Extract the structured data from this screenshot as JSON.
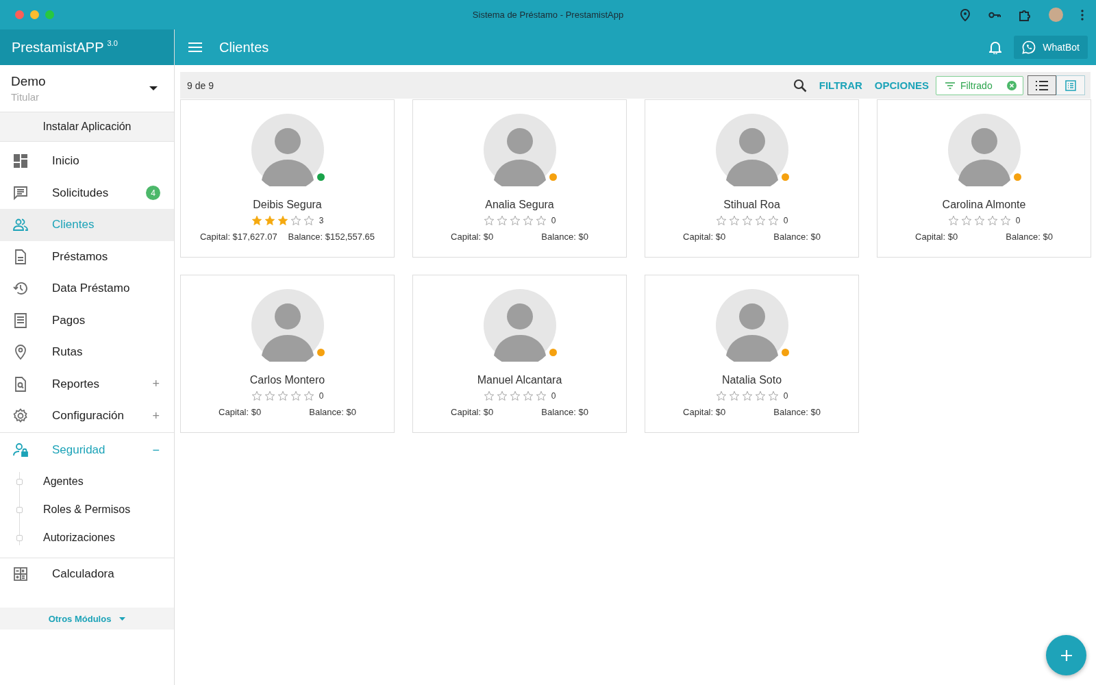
{
  "window": {
    "title": "Sistema de Préstamo - PrestamistApp"
  },
  "app": {
    "name": "PrestamistAPP",
    "version": "3.0",
    "page_title": "Clientes",
    "whatbot": "WhatBot"
  },
  "account": {
    "name": "Demo",
    "role": "Titular"
  },
  "install_button": "Instalar Aplicación",
  "sidebar": {
    "items": [
      {
        "label": "Inicio",
        "selected": false
      },
      {
        "label": "Solicitudes",
        "selected": false,
        "badge": "4"
      },
      {
        "label": "Clientes",
        "selected": true
      },
      {
        "label": "Préstamos",
        "selected": false
      },
      {
        "label": "Data Préstamo",
        "selected": false
      },
      {
        "label": "Pagos",
        "selected": false
      },
      {
        "label": "Rutas",
        "selected": false
      },
      {
        "label": "Reportes",
        "selected": false,
        "toggle": "+",
        "expanded": false
      },
      {
        "label": "Configuración",
        "selected": false,
        "toggle": "+",
        "expanded": false
      },
      {
        "label": "Seguridad",
        "selected": false,
        "toggle": "−",
        "expanded": true,
        "children": [
          {
            "label": "Agentes"
          },
          {
            "label": "Roles & Permisos"
          },
          {
            "label": "Autorizaciones"
          }
        ]
      },
      {
        "label": "Calculadora",
        "selected": false
      }
    ],
    "more": "Otros Módulos"
  },
  "toolbar": {
    "count": "9 de 9",
    "filter": "FILTRAR",
    "options": "OPCIONES",
    "filter_chip": "Filtrado",
    "views": [
      {
        "kind": "list",
        "selected": true
      },
      {
        "kind": "details",
        "selected": false
      }
    ]
  },
  "clients": [
    {
      "name": "Deibis Segura",
      "stars": 3,
      "rating": "3",
      "capital": "Capital: $17,627.07",
      "balance": "Balance: $152,557.65",
      "color": "#1aa34a"
    },
    {
      "name": "Analia Segura",
      "stars": 0,
      "rating": "0",
      "capital": "Capital: $0",
      "balance": "Balance: $0",
      "color": "#f5a10f"
    },
    {
      "name": "Stihual Roa",
      "stars": 0,
      "rating": "0",
      "capital": "Capital: $0",
      "balance": "Balance: $0",
      "color": "#f5a10f"
    },
    {
      "name": "Carolina Almonte",
      "stars": 0,
      "rating": "0",
      "capital": "Capital: $0",
      "balance": "Balance: $0",
      "color": "#f5a10f"
    },
    {
      "name": "Carlos Montero",
      "stars": 0,
      "rating": "0",
      "capital": "Capital: $0",
      "balance": "Balance: $0",
      "color": "#f5a10f"
    },
    {
      "name": "Manuel Alcantara",
      "stars": 0,
      "rating": "0",
      "capital": "Capital: $0",
      "balance": "Balance: $0",
      "color": "#f5a10f"
    },
    {
      "name": "Natalia Soto",
      "stars": 0,
      "rating": "0",
      "capital": "Capital: $0",
      "balance": "Balance: $0",
      "color": "#f5a10f"
    }
  ]
}
